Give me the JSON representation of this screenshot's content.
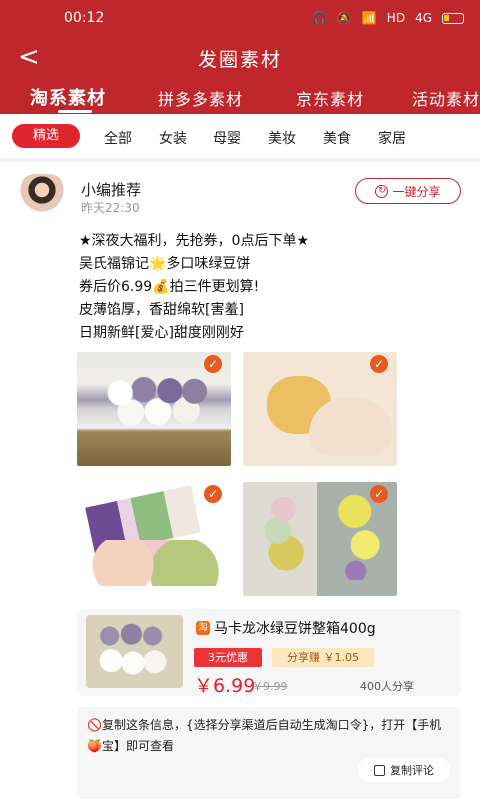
{
  "status": {
    "time": "00:12",
    "network": "HD",
    "signal": "4G"
  },
  "header": {
    "back_label": "<",
    "title": "发圈素材"
  },
  "tabs": [
    {
      "label": "淘系素材"
    },
    {
      "label": "拼多多素材"
    },
    {
      "label": "京东素材"
    },
    {
      "label": "活动素材"
    }
  ],
  "categories": [
    "精选",
    "全部",
    "女装",
    "母婴",
    "美妆",
    "美食",
    "家居"
  ],
  "post": {
    "author": "小编推荐",
    "time": "昨天22:30",
    "share_button": "一键分享",
    "lines": [
      "★深夜大福利，先抢券，0点后下单★",
      "吴氏福锦记🌟多口味绿豆饼",
      "券后价6.99💰拍三件更划算!",
      "皮薄馅厚，香甜绵软[害羞]",
      "日期新鲜[爱心]甜度刚刚好"
    ],
    "selected_mark": "✓"
  },
  "product": {
    "platform": "淘",
    "title": "马卡龙冰绿豆饼整箱400g",
    "coupon": "3元优惠",
    "earn": "分享赚 ￥1.05",
    "price": "￥6.99",
    "old_price": "￥9.99",
    "share_count": "400人分享"
  },
  "copy_hint": {
    "text": "🚫复制这条信息，{选择分享渠道后自动生成淘口令}，打开【手机🍑宝】即可查看",
    "button": "复制评论"
  },
  "icons": {
    "back": "chevron-left-icon",
    "share": "refresh-share-icon",
    "copy": "copy-icon",
    "check": "check-icon"
  },
  "colors": {
    "primary": "#c0272d",
    "accent": "#e51f2a",
    "gold": "#f5c518"
  }
}
